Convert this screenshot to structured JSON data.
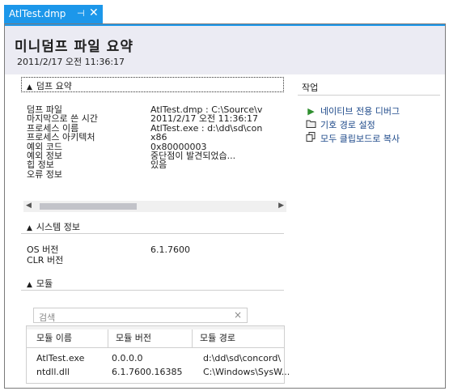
{
  "tab": {
    "title": "AtlTest.dmp",
    "pin_glyph": "⊣",
    "close_glyph": "✕"
  },
  "header": {
    "title": "미니덤프 파일 요약",
    "datetime": "2011/2/17 오전 11:36:17"
  },
  "dump_summary": {
    "heading": "덤프 요약",
    "rows": [
      {
        "label": "덤프 파일",
        "value": "AtlTest.dmp : C:\\Source\\v"
      },
      {
        "label": "마지막으로 쓴 시간",
        "value": "2011/2/17 오전 11:36:17"
      },
      {
        "label": "프로세스 이름",
        "value": "AtlTest.exe : d:\\dd\\sd\\con"
      },
      {
        "label": "프로세스 아키텍처",
        "value": "x86"
      },
      {
        "label": "예외 코드",
        "value": "0x80000003"
      },
      {
        "label": "예외 정보",
        "value": "중단점이 발견되었습..."
      },
      {
        "label": "힙 정보",
        "value": "있음"
      },
      {
        "label": "오류 정보",
        "value": ""
      }
    ]
  },
  "system_info": {
    "heading": "시스템 정보",
    "rows": [
      {
        "label": "OS 버전",
        "value": "6.1.7600"
      },
      {
        "label": "CLR 버전",
        "value": ""
      }
    ]
  },
  "modules": {
    "heading": "모듈",
    "search_placeholder": "검색",
    "clear_glyph": "×",
    "columns": [
      "모듈 이름",
      "모듈 버전",
      "모듈 경로"
    ],
    "rows": [
      [
        "AtlTest.exe",
        "0.0.0.0",
        "d:\\dd\\sd\\concord\\"
      ],
      [
        "ntdll.dll",
        "6.1.7600.16385",
        "C:\\Windows\\SysW..."
      ]
    ]
  },
  "actions": {
    "heading": "작업",
    "items": [
      {
        "label": "네이티브 전용 디버그",
        "icon": "play-icon"
      },
      {
        "label": "기호 경로 설정",
        "icon": "folder-icon"
      },
      {
        "label": "모두 클립보드로 복사",
        "icon": "copy-icon"
      }
    ]
  },
  "colors": {
    "accent": "#1c97ea",
    "header_bg": "#ebebf3",
    "link": "#1e4a8a"
  }
}
